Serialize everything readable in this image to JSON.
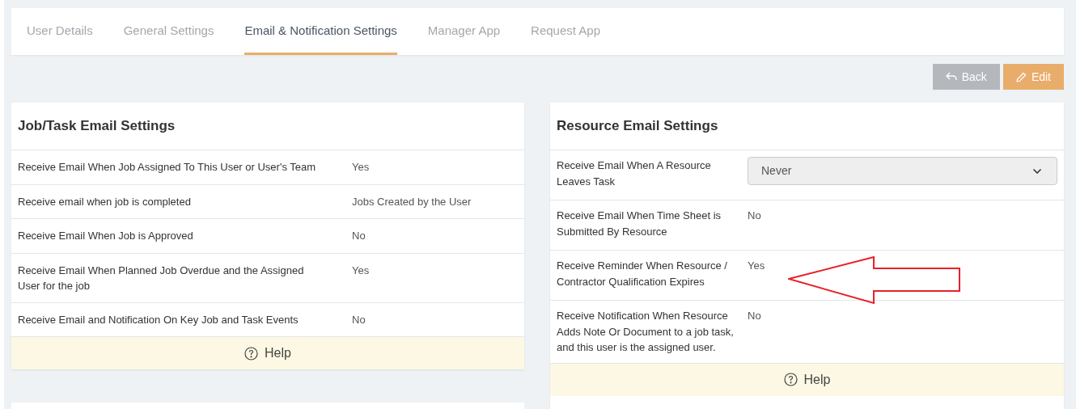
{
  "tabs": [
    {
      "label": "User Details",
      "selected": false
    },
    {
      "label": "General Settings",
      "selected": false
    },
    {
      "label": "Email & Notification Settings",
      "selected": true
    },
    {
      "label": "Manager App",
      "selected": false
    },
    {
      "label": "Request App",
      "selected": false
    }
  ],
  "actions": [
    {
      "kind": "back",
      "label": "Back"
    },
    {
      "kind": "edit",
      "label": "Edit"
    }
  ],
  "panels": [
    {
      "title": "Job/Task Email Settings",
      "help": "Help",
      "rows": [
        {
          "kind": "text",
          "label": "Receive Email When Job Assigned To This User or User's Team",
          "value": "Yes"
        },
        {
          "kind": "text",
          "label": "Receive email when job is completed",
          "value": "Jobs Created by the User"
        },
        {
          "kind": "text",
          "label": "Receive Email When Job is Approved",
          "value": "No"
        },
        {
          "kind": "text",
          "label": "Receive Email When Planned Job Overdue and the Assigned User for the job",
          "value": "Yes"
        },
        {
          "kind": "text",
          "label": "Receive Email and Notification On Key Job and Task Events",
          "value": "No"
        }
      ]
    },
    {
      "title": "Resource Email Settings",
      "help": "Help",
      "rows": [
        {
          "kind": "select",
          "label": "Receive Email When A Resource Leaves Task",
          "value": "Never"
        },
        {
          "kind": "text",
          "label": "Receive Email When Time Sheet is Submitted By Resource",
          "value": "No"
        },
        {
          "kind": "text",
          "label": "Receive Reminder When Resource / Contractor Qualification Expires",
          "value": "Yes",
          "highlighted": true
        },
        {
          "kind": "text",
          "label": "Receive Notification When Resource Adds Note Or Document to a job task, and this user is the assigned user.",
          "value": "No"
        }
      ]
    }
  ]
}
